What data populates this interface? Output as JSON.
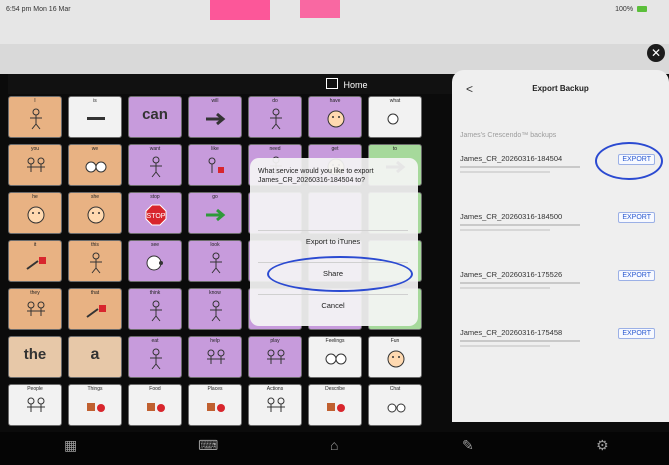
{
  "status": {
    "time": "6:54 pm  Mon 16 Mar",
    "battery": "100%"
  },
  "topbar": {
    "title": "Home"
  },
  "cells": [
    {
      "label": "I",
      "color": "orange",
      "icon": "person-icon"
    },
    {
      "label": "is",
      "color": "white",
      "icon": "line-icon"
    },
    {
      "label": "",
      "color": "purple",
      "icon": "",
      "big": "can"
    },
    {
      "label": "will",
      "color": "purple",
      "icon": "arrow-icon"
    },
    {
      "label": "do",
      "color": "purple",
      "icon": "person-icon"
    },
    {
      "label": "have",
      "color": "purple",
      "icon": "face-icon"
    },
    {
      "label": "what",
      "color": "white",
      "icon": "question-icon"
    },
    {
      "label": "you",
      "color": "orange",
      "icon": "people-icon"
    },
    {
      "label": "we",
      "color": "orange",
      "icon": "faces-icon"
    },
    {
      "label": "want",
      "color": "purple",
      "icon": "person-icon"
    },
    {
      "label": "like",
      "color": "purple",
      "icon": "heart-icon"
    },
    {
      "label": "need",
      "color": "purple",
      "icon": "person-icon"
    },
    {
      "label": "get",
      "color": "purple",
      "icon": "face-icon"
    },
    {
      "label": "to",
      "color": "green",
      "icon": "arrow-icon"
    },
    {
      "label": "he",
      "color": "orange",
      "icon": "face-icon"
    },
    {
      "label": "she",
      "color": "orange",
      "icon": "face-icon"
    },
    {
      "label": "stop",
      "color": "purple",
      "icon": "stop-icon",
      "stopText": "STOP"
    },
    {
      "label": "go",
      "color": "purple",
      "icon": "go-arrow-icon"
    },
    {
      "label": "",
      "color": "purple",
      "icon": ""
    },
    {
      "label": "",
      "color": "purple",
      "icon": ""
    },
    {
      "label": "",
      "color": "green",
      "icon": ""
    },
    {
      "label": "it",
      "color": "orange",
      "icon": "point-icon"
    },
    {
      "label": "this",
      "color": "orange",
      "icon": "person-icon"
    },
    {
      "label": "see",
      "color": "purple",
      "icon": "eye-icon"
    },
    {
      "label": "look",
      "color": "purple",
      "icon": "person-icon"
    },
    {
      "label": "",
      "color": "purple",
      "icon": ""
    },
    {
      "label": "",
      "color": "purple",
      "icon": ""
    },
    {
      "label": "",
      "color": "green",
      "icon": ""
    },
    {
      "label": "they",
      "color": "orange",
      "icon": "people-icon"
    },
    {
      "label": "that",
      "color": "orange",
      "icon": "point-icon"
    },
    {
      "label": "think",
      "color": "purple",
      "icon": "person-icon"
    },
    {
      "label": "know",
      "color": "purple",
      "icon": "person-icon"
    },
    {
      "label": "",
      "color": "purple",
      "icon": ""
    },
    {
      "label": "",
      "color": "purple",
      "icon": ""
    },
    {
      "label": "",
      "color": "green",
      "icon": ""
    },
    {
      "label": "",
      "color": "tan",
      "icon": "",
      "big": "the"
    },
    {
      "label": "",
      "color": "tan",
      "icon": "",
      "big": "a"
    },
    {
      "label": "eat",
      "color": "purple",
      "icon": "person-icon"
    },
    {
      "label": "help",
      "color": "purple",
      "icon": "people-icon"
    },
    {
      "label": "play",
      "color": "purple",
      "icon": "people-icon"
    },
    {
      "label": "Feelings",
      "color": "white",
      "icon": "faces-icon"
    },
    {
      "label": "Fun",
      "color": "white",
      "icon": "face-icon"
    },
    {
      "label": "People",
      "color": "white",
      "icon": "people-icon"
    },
    {
      "label": "Things",
      "color": "white",
      "icon": "things-icon"
    },
    {
      "label": "Food",
      "color": "white",
      "icon": "food-icon"
    },
    {
      "label": "Places",
      "color": "white",
      "icon": "places-icon"
    },
    {
      "label": "Actions",
      "color": "white",
      "icon": "people-icon"
    },
    {
      "label": "Describe",
      "color": "white",
      "icon": "shapes-icon"
    },
    {
      "label": "Chat",
      "color": "white",
      "icon": "chat-icon"
    }
  ],
  "sheet": {
    "message": "What service would you like to export James_CR_20260316-184504 to?",
    "opt1": "Export to iTunes",
    "opt2": "Share",
    "opt3": "Cancel"
  },
  "panel": {
    "back": "<",
    "title": "Export Backup",
    "section": "James's Crescendo™ backups",
    "backups": [
      {
        "name": "James_CR_20260316-184504",
        "button": "EXPORT"
      },
      {
        "name": "James_CR_20260316-184500",
        "button": "EXPORT"
      },
      {
        "name": "James_CR_20260316-175526",
        "button": "EXPORT"
      },
      {
        "name": "James_CR_20260316-175458",
        "button": "EXPORT"
      }
    ]
  },
  "close": "✕",
  "bottombar": {
    "icons": [
      "grid-icon",
      "keyboard-icon",
      "home-outline-icon",
      "pencil-icon",
      "gear-icon"
    ]
  },
  "accent": "#2b4ad1"
}
